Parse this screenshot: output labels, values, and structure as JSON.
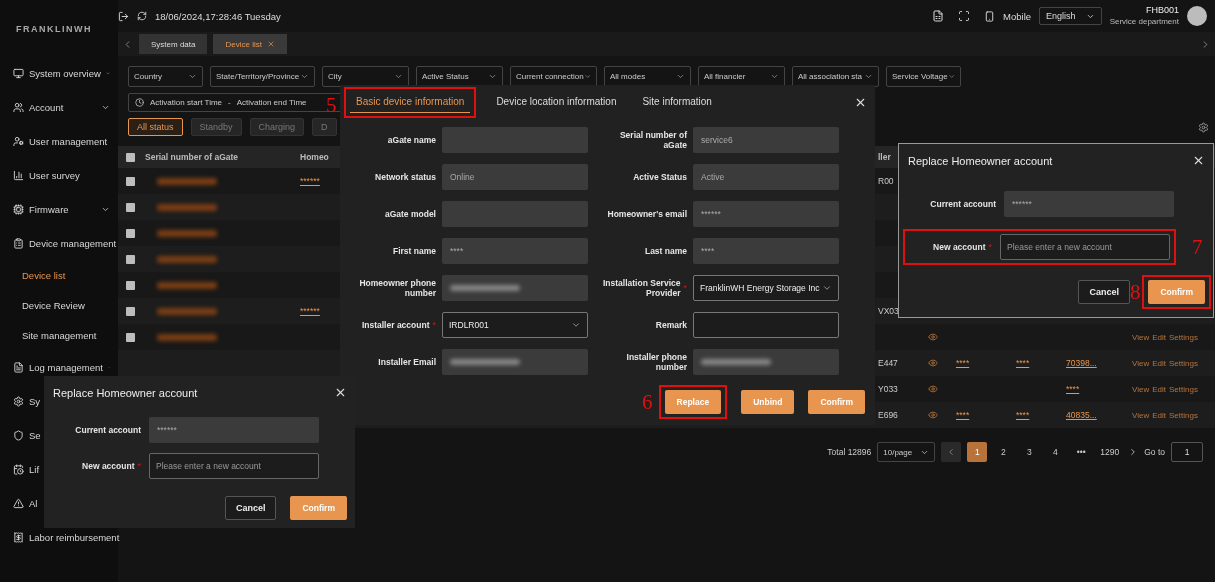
{
  "sidebar": {
    "logo": "FRANKLINWH",
    "items": [
      {
        "label": "System overview",
        "kind": "group",
        "selected": false
      },
      {
        "label": "Account",
        "kind": "group",
        "selected": false
      },
      {
        "label": "User management",
        "kind": "link",
        "selected": false
      },
      {
        "label": "User survey",
        "kind": "link",
        "selected": false
      },
      {
        "label": "Firmware",
        "kind": "group",
        "selected": false
      },
      {
        "label": "Device management",
        "kind": "parent",
        "selected": false,
        "children": [
          {
            "label": "Device list",
            "selected": true
          },
          {
            "label": "Device Review",
            "selected": false
          },
          {
            "label": "Site management",
            "selected": false
          }
        ]
      },
      {
        "label": "Log management",
        "kind": "group",
        "selected": false
      },
      {
        "label": "Sy",
        "kind": "link",
        "selected": false
      },
      {
        "label": "Se",
        "kind": "link",
        "selected": false
      },
      {
        "label": "Lif",
        "kind": "link",
        "selected": false
      },
      {
        "label": "Al",
        "kind": "link",
        "selected": false
      },
      {
        "label": "Labor reimbursement",
        "kind": "link",
        "selected": false
      }
    ]
  },
  "header": {
    "datetime": "18/06/2024,17:28:46 Tuesday",
    "mobile": "Mobile",
    "language": "English",
    "user": "FHB001",
    "department": "Service department"
  },
  "page_tabs": [
    {
      "label": "System data",
      "selected": false,
      "closable": false
    },
    {
      "label": "Device list",
      "selected": true,
      "closable": true
    }
  ],
  "filters": [
    "Country",
    "State/Territory/Province",
    "City",
    "Active Status",
    "Current connection",
    "All modes",
    "All financier",
    "All association sta",
    "Service Voltage"
  ],
  "date_range": {
    "start": "Activation start Time",
    "separator": "-",
    "end": "Activation end Time"
  },
  "status_buttons": [
    {
      "label": "All status",
      "selected": true
    },
    {
      "label": "Standby",
      "selected": false
    },
    {
      "label": "Charging",
      "selected": false
    },
    {
      "label": "D",
      "selected": false
    }
  ],
  "table": {
    "select_all_checked": false,
    "columns": [
      "Serial number of aGate",
      "Homeo",
      "ller"
    ],
    "rows": [
      {
        "checked": false,
        "serial_redacted": true,
        "homeowner": "******",
        "column_5": "R00"
      },
      {
        "checked": false,
        "serial_redacted": true
      },
      {
        "checked": false,
        "serial_redacted": true
      },
      {
        "checked": false,
        "serial_redacted": true
      },
      {
        "checked": false,
        "serial_redacted": true
      },
      {
        "checked": false,
        "serial_redacted": true,
        "homeowner": "******",
        "column_5": "VX03"
      },
      {
        "checked": false,
        "serial_redacted": true,
        "eye": true,
        "actions": [
          "View",
          "Edit",
          "Settings"
        ]
      },
      {
        "column_5": "E447",
        "eye": true,
        "column_7": "****",
        "column_8": "****",
        "column_9": "70398...",
        "actions": [
          "View",
          "Edit",
          "Settings"
        ]
      },
      {
        "column_5": "Y033",
        "eye": true,
        "column_9": "****",
        "actions": [
          "View",
          "Edit",
          "Settings"
        ]
      },
      {
        "column_5": "E696",
        "eye": true,
        "column_7": "****",
        "column_8": "****",
        "column_9": "40835...",
        "actions": [
          "View",
          "Edit",
          "Settings"
        ]
      }
    ]
  },
  "pagination": {
    "total": "Total 12896",
    "page_size": "10/page",
    "pages": [
      {
        "label": "1",
        "selected": true
      },
      {
        "label": "2",
        "selected": false
      },
      {
        "label": "3",
        "selected": false
      },
      {
        "label": "4",
        "selected": false
      },
      {
        "label": "•••",
        "selected": false
      },
      {
        "label": "1290",
        "selected": false
      }
    ],
    "goto_label": "Go to",
    "goto_value": "1"
  },
  "device_modal": {
    "tabs": [
      {
        "label": "Basic device information",
        "selected": true,
        "callout": "5"
      },
      {
        "label": "Device location information",
        "selected": false
      },
      {
        "label": "Site information",
        "selected": false
      }
    ],
    "fields": [
      {
        "label": "aGate name",
        "kind": "readonly"
      },
      {
        "label": "Serial number of aGate",
        "kind": "readonly",
        "value": "service6"
      },
      {
        "label": "Network status",
        "kind": "readonly",
        "value": "Online"
      },
      {
        "label": "Active Status",
        "kind": "readonly",
        "value": "Active"
      },
      {
        "label": "aGate model",
        "kind": "readonly"
      },
      {
        "label": "Homeowner's email",
        "kind": "readonly",
        "value": "******"
      },
      {
        "label": "First name",
        "kind": "readonly",
        "value": "****"
      },
      {
        "label": "Last name",
        "kind": "readonly",
        "value": "****"
      },
      {
        "label": "Homeowner phone number",
        "kind": "blurred"
      },
      {
        "label": "Installation Service Provider",
        "kind": "select",
        "required_mark": "*",
        "value": "FranklinWH Energy Storage Inc"
      },
      {
        "label": "Installer account",
        "kind": "select",
        "required_mark": "*",
        "value": "IRDLR001"
      },
      {
        "label": "Remark",
        "kind": "input"
      },
      {
        "label": "Installer Email",
        "kind": "blurred"
      },
      {
        "label": "Installer phone number",
        "kind": "blurred"
      }
    ],
    "buttons": [
      {
        "label": "Replace",
        "callout": "6"
      },
      {
        "label": "Unbind"
      },
      {
        "label": "Confirm"
      }
    ]
  },
  "dialogs": [
    {
      "title": "Replace Homeowner account",
      "current_label": "Current account",
      "current_value": "******",
      "new_label": "New account",
      "new_required_mark": "*",
      "new_placeholder": "Please enter a new account",
      "cancel": "Cancel",
      "confirm": "Confirm"
    },
    {
      "title": "Replace Homeowner account",
      "current_label": "Current account",
      "current_value": "******",
      "new_label": "New account",
      "new_required_mark": "*",
      "new_placeholder": "Please enter a new account",
      "new_callout": "7",
      "cancel": "Cancel",
      "confirm": "Confirm",
      "confirm_callout": "8"
    }
  ]
}
